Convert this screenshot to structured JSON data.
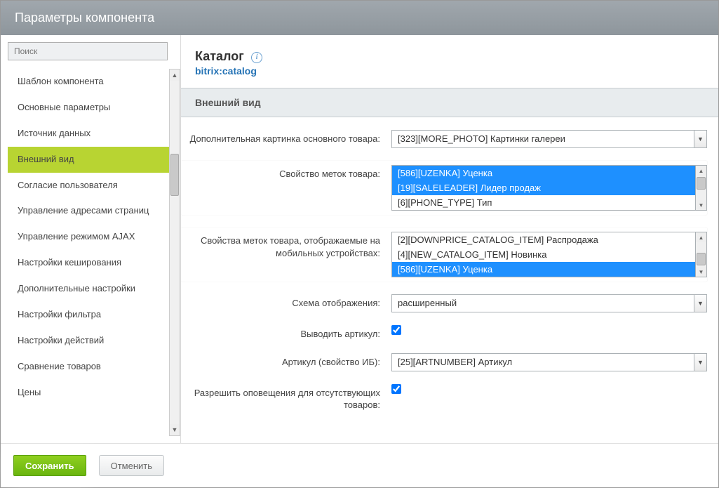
{
  "window_title": "Параметры компонента",
  "search_placeholder": "Поиск",
  "sidebar": {
    "active_index": 3,
    "items": [
      "Шаблон компонента",
      "Основные параметры",
      "Источник данных",
      "Внешний вид",
      "Согласие пользователя",
      "Управление адресами страниц",
      "Управление режимом AJAX",
      "Настройки кеширования",
      "Дополнительные настройки",
      "Настройки фильтра",
      "Настройки действий",
      "Сравнение товаров",
      "Цены"
    ]
  },
  "main": {
    "title": "Каталог",
    "component_id": "bitrix:catalog",
    "section_title": "Внешний вид",
    "fields": {
      "additional_image": {
        "label": "Дополнительная картинка основного товара:",
        "value": "[323][MORE_PHOTO] Картинки галереи"
      },
      "label_props": {
        "label": "Свойство меток товара:",
        "options": [
          {
            "text": "[586][UZENKA] Уценка",
            "selected": true
          },
          {
            "text": "[19][SALELEADER] Лидер продаж",
            "selected": true
          },
          {
            "text": "[6][PHONE_TYPE] Тип",
            "selected": false
          }
        ]
      },
      "mobile_label_props": {
        "label": "Свойства меток товара, отображаемые на мобильных устройствах:",
        "options": [
          {
            "text": "[2][DOWNPRICE_CATALOG_ITEM] Распродажа",
            "selected": false
          },
          {
            "text": "[4][NEW_CATALOG_ITEM] Новинка",
            "selected": false
          },
          {
            "text": "[586][UZENKA] Уценка",
            "selected": true
          }
        ]
      },
      "view_scheme": {
        "label": "Схема отображения:",
        "value": "расширенный"
      },
      "show_sku": {
        "label": "Выводить артикул:",
        "checked": true
      },
      "sku_prop": {
        "label": "Артикул (свойство ИБ):",
        "value": "[25][ARTNUMBER] Артикул"
      },
      "allow_notify": {
        "label": "Разрешить оповещения для отсутствующих товаров:",
        "checked": true
      }
    },
    "buttons": {
      "save": "Сохранить",
      "cancel": "Отменить"
    }
  }
}
